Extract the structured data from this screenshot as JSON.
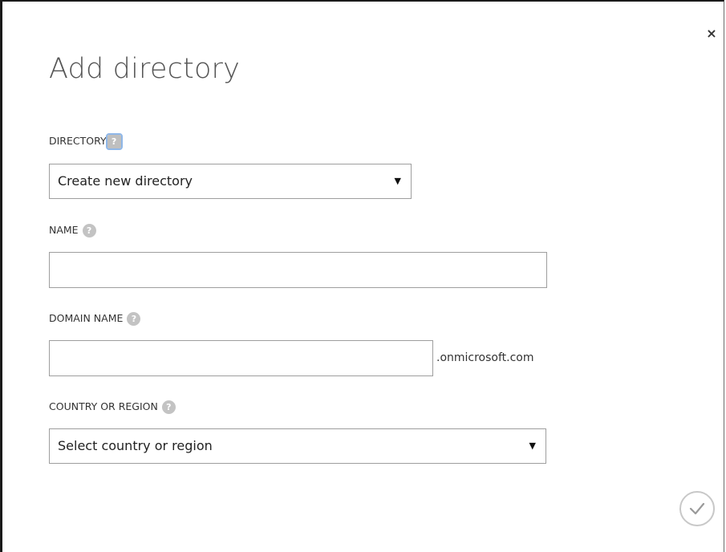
{
  "dialog": {
    "title": "Add directory",
    "close_glyph": "×",
    "confirm_icon": "checkmark-icon"
  },
  "fields": {
    "directory": {
      "label": "DIRECTORY",
      "help_glyph": "?",
      "selected": "Create new directory"
    },
    "name": {
      "label": "NAME",
      "help_glyph": "?",
      "value": ""
    },
    "domain_name": {
      "label": "DOMAIN NAME",
      "help_glyph": "?",
      "value": "",
      "suffix": ".onmicrosoft.com"
    },
    "country": {
      "label": "COUNTRY OR REGION",
      "help_glyph": "?",
      "selected": "Select country or region"
    }
  },
  "dropdown_arrow": "▼",
  "colors": {
    "help_bg": "#c3c3c3",
    "border": "#9e9e9e",
    "focus_outline": "#8fb7e8"
  }
}
